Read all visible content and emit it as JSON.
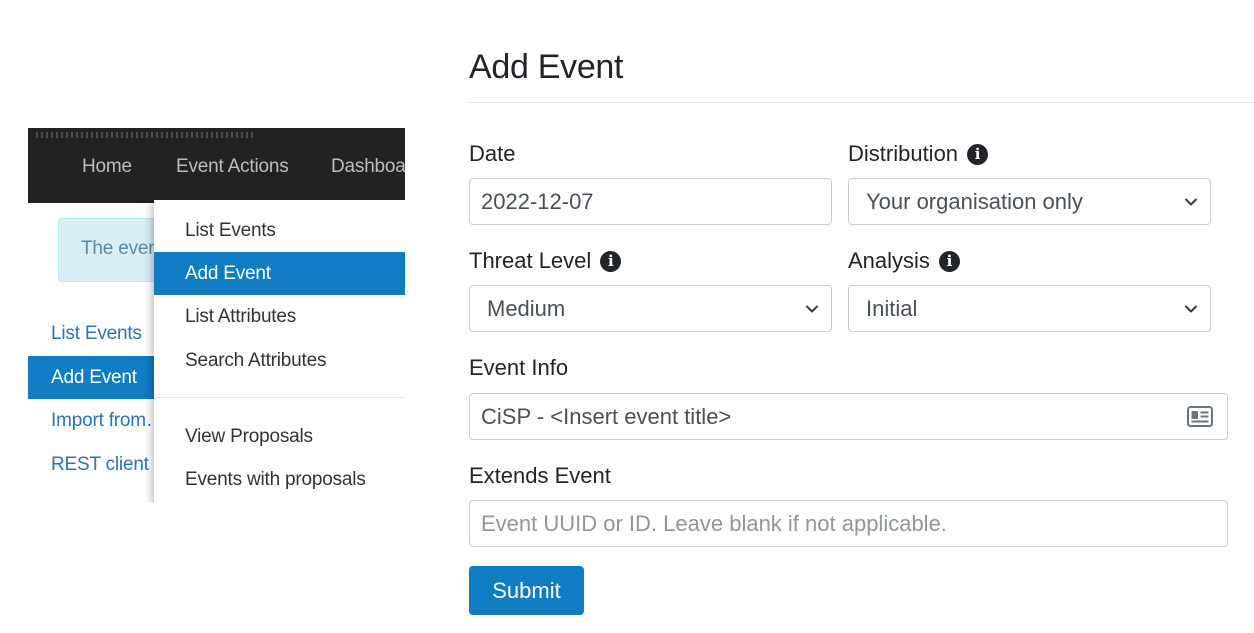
{
  "navbar": {
    "items": [
      "Home",
      "Event Actions",
      "Dashboa"
    ]
  },
  "alert": {
    "text": "The even"
  },
  "sidebar": {
    "items": [
      {
        "label": "List Events",
        "active": false
      },
      {
        "label": "Add Event",
        "active": true
      },
      {
        "label": "Import from…",
        "active": false
      },
      {
        "label": "REST client",
        "active": false
      }
    ]
  },
  "dropdown": {
    "items": [
      {
        "label": "List Events",
        "active": false
      },
      {
        "label": "Add Event",
        "active": true
      },
      {
        "label": "List Attributes",
        "active": false
      },
      {
        "label": "Search Attributes",
        "active": false
      },
      {
        "label": "View Proposals",
        "active": false
      },
      {
        "label": "Events with proposals",
        "active": false
      }
    ]
  },
  "form": {
    "title": "Add Event",
    "date": {
      "label": "Date",
      "value": "2022-12-07"
    },
    "distribution": {
      "label": "Distribution",
      "value": "Your organisation only",
      "info_icon": "info-icon"
    },
    "threat_level": {
      "label": "Threat Level",
      "value": "Medium",
      "info_icon": "info-icon"
    },
    "analysis": {
      "label": "Analysis",
      "value": "Initial",
      "info_icon": "info-icon"
    },
    "event_info": {
      "label": "Event Info",
      "value": "CiSP - <Insert event title>",
      "icon": "contact-card-icon"
    },
    "extends_event": {
      "label": "Extends Event",
      "placeholder": "Event UUID or ID. Leave blank if not applicable."
    },
    "submit_label": "Submit"
  },
  "colors": {
    "accent": "#0f7cc4",
    "navbar": "#222222",
    "alert_bg": "#d9edf7",
    "link": "#2a73b8"
  }
}
